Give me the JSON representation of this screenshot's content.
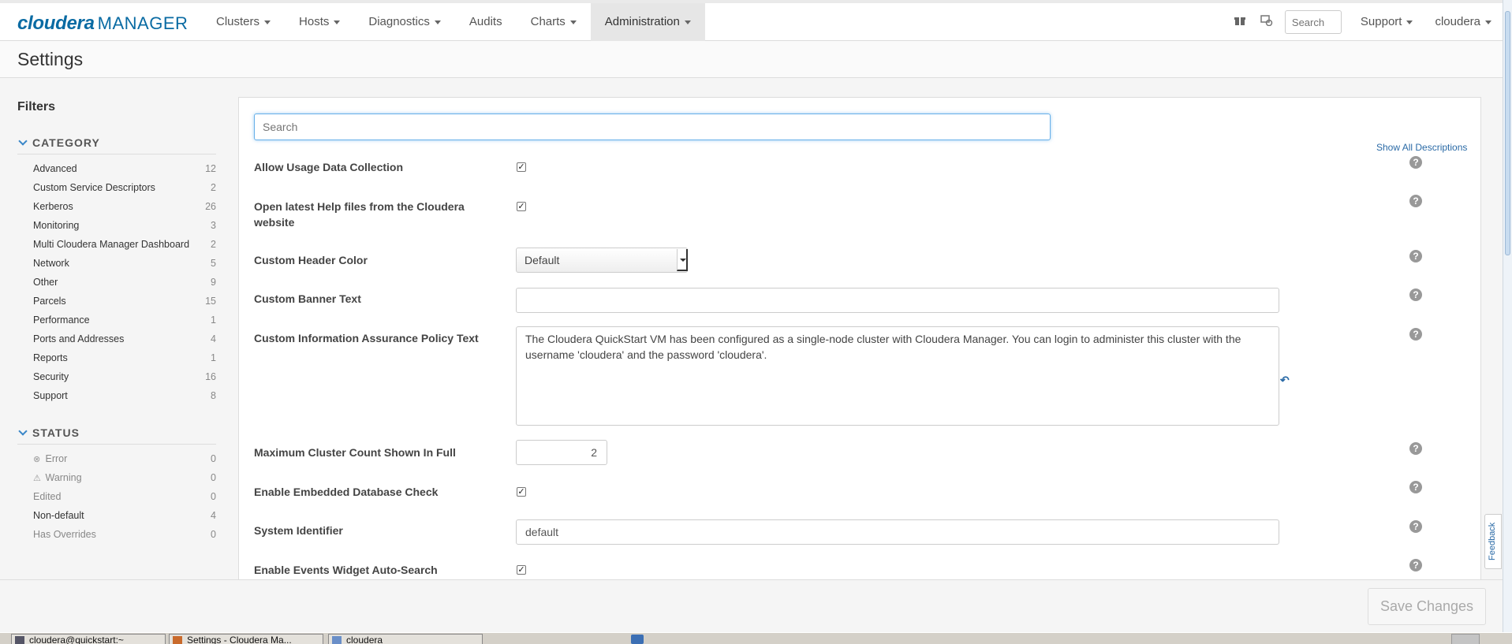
{
  "brand": {
    "name": "cloudera",
    "product": "MANAGER"
  },
  "nav": {
    "items": [
      {
        "label": "Clusters",
        "dropdown": true
      },
      {
        "label": "Hosts",
        "dropdown": true
      },
      {
        "label": "Diagnostics",
        "dropdown": true
      },
      {
        "label": "Audits",
        "dropdown": false
      },
      {
        "label": "Charts",
        "dropdown": true
      },
      {
        "label": "Administration",
        "dropdown": true,
        "active": true
      }
    ],
    "search_placeholder": "Search",
    "support_label": "Support",
    "user_label": "cloudera"
  },
  "page": {
    "title": "Settings"
  },
  "sidebar": {
    "filters_title": "Filters",
    "category_title": "CATEGORY",
    "categories": [
      {
        "label": "Advanced",
        "count": "12"
      },
      {
        "label": "Custom Service Descriptors",
        "count": "2"
      },
      {
        "label": "Kerberos",
        "count": "26"
      },
      {
        "label": "Monitoring",
        "count": "3"
      },
      {
        "label": "Multi Cloudera Manager Dashboard",
        "count": "2"
      },
      {
        "label": "Network",
        "count": "5"
      },
      {
        "label": "Other",
        "count": "9"
      },
      {
        "label": "Parcels",
        "count": "15"
      },
      {
        "label": "Performance",
        "count": "1"
      },
      {
        "label": "Ports and Addresses",
        "count": "4"
      },
      {
        "label": "Reports",
        "count": "1"
      },
      {
        "label": "Security",
        "count": "16"
      },
      {
        "label": "Support",
        "count": "8"
      }
    ],
    "status_title": "STATUS",
    "statuses": [
      {
        "label": "Error",
        "count": "0",
        "icon": "error-icon"
      },
      {
        "label": "Warning",
        "count": "0",
        "icon": "warning-icon"
      },
      {
        "label": "Edited",
        "count": "0"
      },
      {
        "label": "Non-default",
        "count": "4"
      },
      {
        "label": "Has Overrides",
        "count": "0"
      }
    ]
  },
  "main": {
    "search_placeholder": "Search",
    "show_all_label": "Show All Descriptions",
    "properties": {
      "usage": {
        "label": "Allow Usage Data Collection",
        "checked": true
      },
      "help_files": {
        "label": "Open latest Help files from the Cloudera website",
        "checked": true
      },
      "header_color": {
        "label": "Custom Header Color",
        "value": "Default"
      },
      "banner": {
        "label": "Custom Banner Text",
        "value": ""
      },
      "policy": {
        "label": "Custom Information Assurance Policy Text",
        "value": "The Cloudera QuickStart VM has been configured as a single-node cluster with Cloudera Manager. You can login to administer this cluster with the username 'cloudera' and the password 'cloudera'."
      },
      "max_cluster": {
        "label": "Maximum Cluster Count Shown In Full",
        "value": "2"
      },
      "embedded_db": {
        "label": "Enable Embedded Database Check",
        "checked": true
      },
      "system_id": {
        "label": "System Identifier",
        "value": "default"
      },
      "events_widget": {
        "label": "Enable Events Widget Auto-Search",
        "checked": true
      }
    }
  },
  "footer": {
    "save_label": "Save Changes"
  },
  "feedback_label": "Feedback",
  "taskbar": {
    "items": [
      {
        "label": "cloudera@quickstart:~"
      },
      {
        "label": "Settings - Cloudera Ma..."
      },
      {
        "label": "cloudera"
      }
    ]
  },
  "colors": {
    "brand_blue": "#0a6ba3",
    "link_blue": "#2a6aa6",
    "focus_blue": "#66afe9"
  }
}
